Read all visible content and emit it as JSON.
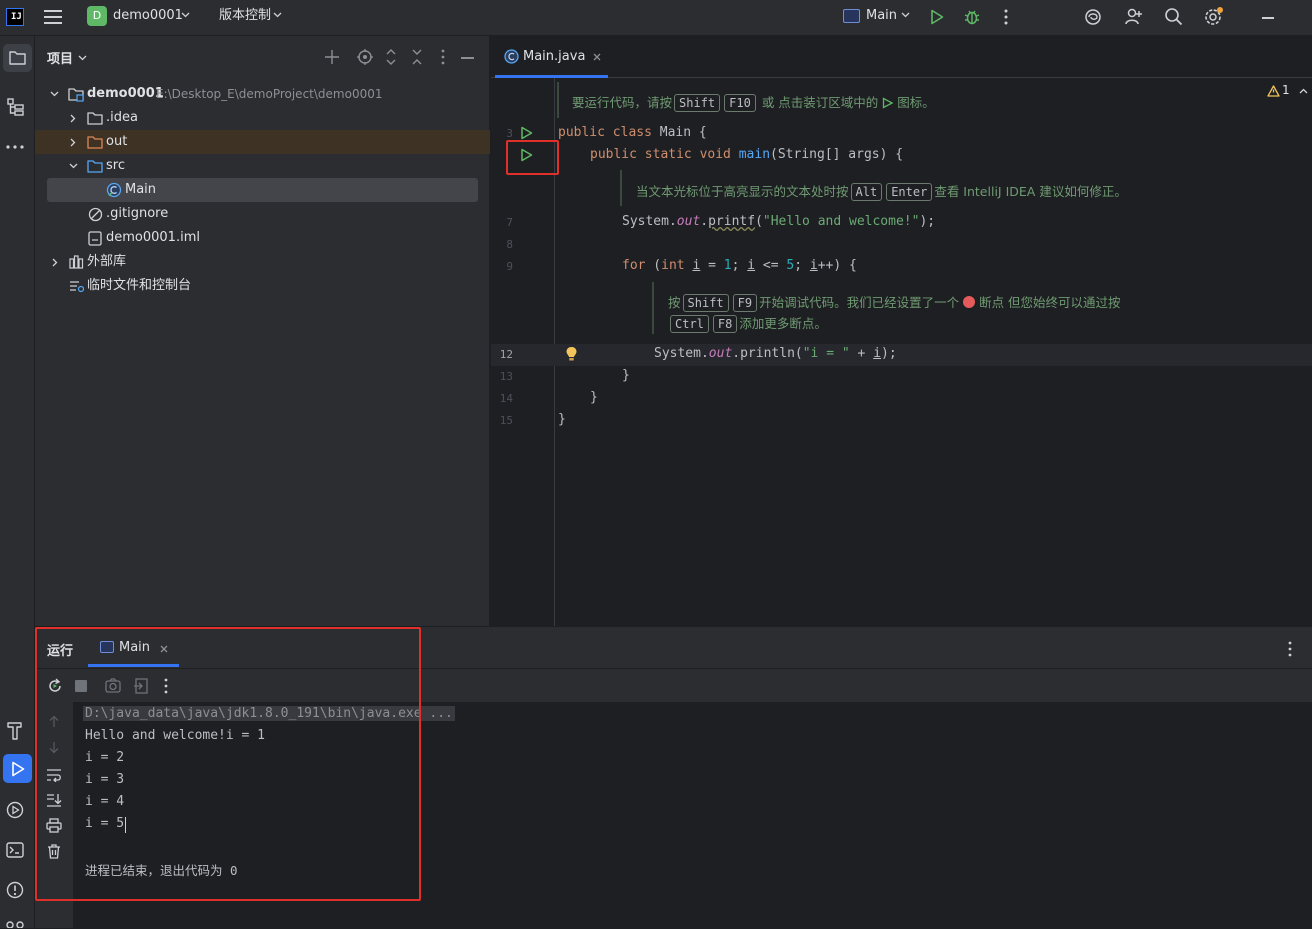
{
  "titlebar": {
    "project_badge": "D",
    "project_name": "demo0001",
    "vcs_label": "版本控制",
    "run_config": "Main"
  },
  "project_panel": {
    "title": "项目",
    "root_name": "demo0001",
    "root_path": "E:\\Desktop_E\\demoProject\\demo0001",
    "items": {
      "idea": ".idea",
      "out": "out",
      "src": "src",
      "main": "Main",
      "gitignore": ".gitignore",
      "iml": "demo0001.iml",
      "external": "外部库",
      "scratches": "临时文件和控制台"
    }
  },
  "editor": {
    "tab_label": "Main.java",
    "warning_count": "1",
    "hint1": {
      "pre": "要运行代码，请按",
      "k1": "Shift",
      "k2": "F10",
      "post": "或 点击装订区域中的",
      "tail": "图标。"
    },
    "hint2": {
      "pre": "当文本光标位于高亮显示的文本处时按",
      "k1": "Alt",
      "k2": "Enter",
      "post": "查看 IntelliJ IDEA 建议如何修正。"
    },
    "hint3": {
      "pre": "按",
      "k1": "Shift",
      "k2": "F9",
      "mid": "开始调试代码。我们已经设置了一个",
      "post": "断点 但您始终可以通过按",
      "k3": "Ctrl",
      "k4": "F8",
      "tail": "添加更多断点。"
    },
    "line_numbers": [
      "3",
      "7",
      "8",
      "9",
      "12",
      "13",
      "14",
      "15"
    ],
    "code": {
      "l3_kw": "public class",
      "l3_name": "Main {",
      "l4_kw": "public static void",
      "l4_fn": "main",
      "l4_rest": "(String[] args) {",
      "l7_a": "System.",
      "l7_out": "out",
      "l7_b": ".",
      "l7_fn": "printf",
      "l7_c": "(",
      "l7_str": "\"Hello and welcome!\"",
      "l7_d": ");",
      "l9_kw": "for",
      "l9_a": " (",
      "l9_int": "int",
      "l9_b": " ",
      "l9_i1": "i",
      "l9_c": " = ",
      "l9_n1": "1",
      "l9_d": "; ",
      "l9_i2": "i",
      "l9_e": " <= ",
      "l9_n2": "5",
      "l9_f": "; ",
      "l9_i3": "i",
      "l9_g": "++) {",
      "l12_a": "System.",
      "l12_out": "out",
      "l12_b": ".println(",
      "l12_str": "\"i = \"",
      "l12_c": " + ",
      "l12_i": "i",
      "l12_d": ");",
      "l13": "}",
      "l14": "}",
      "l15": "}"
    }
  },
  "run_panel": {
    "title": "运行",
    "tab_label": "Main",
    "output": {
      "cmd": "D:\\java_data\\java\\jdk1.8.0_191\\bin\\java.exe ...",
      "line1": "Hello and welcome!i = 1",
      "line2": "i = 2",
      "line3": "i = 3",
      "line4": "i = 4",
      "line5": "i = 5",
      "exit": "进程已结束，退出代码为 0"
    }
  },
  "colors": {
    "accent": "#3574f0",
    "run_green": "#5fb865",
    "highlight_red": "#e0302a",
    "breakpoint": "#e55b5b",
    "warning": "#f2c55c"
  }
}
